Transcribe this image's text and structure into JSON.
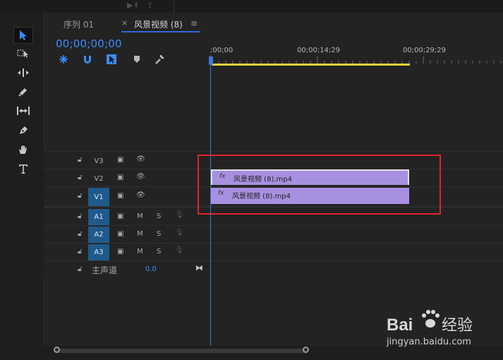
{
  "tabs": [
    {
      "label": "序列 01"
    },
    {
      "label": "风景视频 (8)"
    }
  ],
  "tab_close": "×",
  "tab_menu": "≡",
  "timecode": "00;00;00;00",
  "ruler": {
    "labels": [
      ";00;00",
      "00;00;14;29",
      "00;00;29;29"
    ]
  },
  "video_tracks": [
    {
      "name": "V3"
    },
    {
      "name": "V2"
    },
    {
      "name": "V1"
    }
  ],
  "audio_tracks": [
    {
      "name": "A1",
      "m": "M",
      "s": "S"
    },
    {
      "name": "A2",
      "m": "M",
      "s": "S"
    },
    {
      "name": "A3",
      "m": "M",
      "s": "S"
    }
  ],
  "master": {
    "label": "主声道",
    "value": "0.0"
  },
  "clips": [
    {
      "track": "V2",
      "fx": "fx",
      "label": "风景视频 (8).mp4"
    },
    {
      "track": "V1",
      "fx": "fx",
      "label": "风景视频 (8).mp4"
    }
  ],
  "watermark": {
    "text": "jingyan.baidu.com",
    "brand": "Bai",
    "brand2": "经验"
  },
  "colors": {
    "accent": "#3b8cff",
    "clip": "#a890e0",
    "work_area": "#e3d33a",
    "highlight": "#e0242d"
  }
}
